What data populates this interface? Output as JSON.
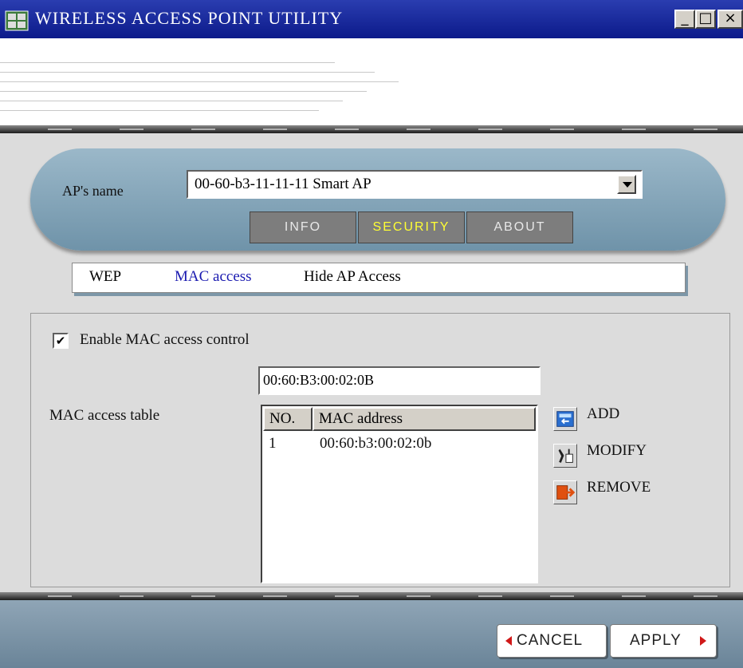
{
  "window": {
    "title": "WIRELESS ACCESS POINT UTILITY",
    "minimize_glyph": "_",
    "maximize_glyph": "□",
    "close_glyph": "×",
    "icon": "network-computer-icon"
  },
  "ap": {
    "label": "AP's name",
    "selected": "00-60-b3-11-11-11 Smart AP"
  },
  "tabs": [
    {
      "label": "INFO",
      "active": false
    },
    {
      "label": "SECURITY",
      "active": true
    },
    {
      "label": "ABOUT",
      "active": false
    }
  ],
  "subnav": [
    {
      "label": "WEP",
      "active": false
    },
    {
      "label": "MAC access",
      "active": true
    },
    {
      "label": "Hide AP Access",
      "active": false
    }
  ],
  "mac": {
    "enable_checked": true,
    "check_glyph": "✔",
    "enable_label": "Enable MAC access control",
    "input_value": "00:60:B3:00:02:0B",
    "table_label": "MAC access table",
    "columns": [
      "NO.",
      "MAC address"
    ],
    "rows": [
      {
        "no": "1",
        "mac": "00:60:b3:00:02:0b"
      }
    ]
  },
  "actions": [
    {
      "label": "ADD",
      "icon": "add-entry-icon"
    },
    {
      "label": "MODIFY",
      "icon": "modify-tools-icon"
    },
    {
      "label": "REMOVE",
      "icon": "remove-exit-icon"
    }
  ],
  "footer": {
    "cancel_label": "CANCEL",
    "apply_label": "APPLY"
  },
  "colors": {
    "titlebar": "#0c1a8a",
    "pill": "#7f9fb3",
    "active_tab_text": "#ffff33",
    "active_subnav": "#1a1ab0",
    "footer": "#7a92a5",
    "button_arrow": "#d01818"
  }
}
